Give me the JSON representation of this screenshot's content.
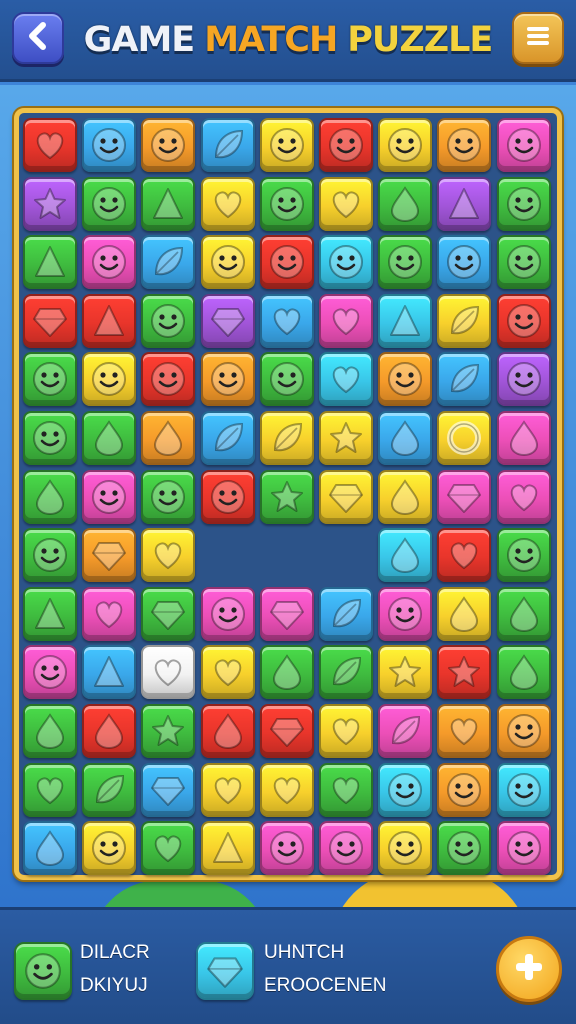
{
  "header": {
    "title_word1": "GAME",
    "title_word2": "MATCH",
    "title_word3": "PUZZLE",
    "back_icon": "chevron-left-icon",
    "menu_icon": "hamburger-menu-icon"
  },
  "colors": {
    "red": "#e8352b",
    "blue": "#3aa7ea",
    "orange": "#f59a2a",
    "cyan": "#39c6e8",
    "yellow": "#f7d02c",
    "pink": "#ec4fb7",
    "green": "#3fbb3f",
    "purple": "#a155d8",
    "white": "#f2f2f2",
    "board_frame": "#f0c24a"
  },
  "board": {
    "cols": 9,
    "rows": 13,
    "empty_cells": [
      [
        8,
        3
      ],
      [
        8,
        4
      ],
      [
        8,
        5
      ],
      [
        9,
        3
      ],
      [
        9,
        4
      ],
      [
        9,
        5
      ]
    ],
    "tiles": [
      [
        "red:heart",
        "blue:face",
        "orange:face",
        "blue:leaf",
        "yellow:face",
        "red:face",
        "yellow:face",
        "orange:face",
        "pink:face"
      ],
      [
        "purple:star",
        "green:face",
        "green:triangle",
        "yellow:heart",
        "green:face",
        "yellow:heart",
        "green:drop",
        "purple:triangle",
        "green:face"
      ],
      [
        "green:triangle",
        "pink:face",
        "blue:leaf",
        "yellow:face",
        "red:face",
        "cyan:face",
        "green:face",
        "blue:face",
        "green:face"
      ],
      [
        "red:gem",
        "red:triangle",
        "green:face",
        "purple:gem",
        "blue:heart",
        "pink:heart",
        "cyan:triangle",
        "yellow:leaf",
        "red:face"
      ],
      [
        "green:face",
        "yellow:face",
        "red:face",
        "orange:face",
        "green:face",
        "cyan:heart",
        "orange:face",
        "blue:leaf",
        "purple:face"
      ],
      [
        "green:face",
        "green:drop",
        "orange:drop",
        "blue:leaf",
        "yellow:leaf",
        "yellow:star",
        "blue:drop",
        "yellow:circle",
        "pink:drop"
      ],
      [
        "green:drop",
        "pink:face",
        "green:face",
        "red:face",
        "green:star",
        "yellow:gem",
        "yellow:drop",
        "pink:gem",
        "pink:heart"
      ],
      [
        "green:face",
        "orange:gem",
        "yellow:heart",
        "",
        "",
        "",
        "cyan:drop",
        "red:heart",
        "green:face"
      ],
      [
        "green:triangle",
        "pink:heart",
        "green:gem",
        "pink:face",
        "pink:gem",
        "blue:leaf",
        "pink:face",
        "yellow:drop",
        "green:drop"
      ],
      [
        "pink:face",
        "blue:triangle",
        "white:heart",
        "yellow:heart",
        "green:drop",
        "green:leaf",
        "yellow:star",
        "red:star",
        "green:drop"
      ],
      [
        "green:drop",
        "red:drop",
        "green:star",
        "red:drop",
        "red:gem",
        "yellow:heart",
        "pink:leaf",
        "orange:heart",
        "orange:face"
      ],
      [
        "green:heart",
        "green:leaf",
        "blue:gem",
        "yellow:heart",
        "yellow:heart",
        "green:heart",
        "cyan:face",
        "orange:face",
        "cyan:face"
      ],
      [
        "blue:drop",
        "yellow:face",
        "green:heart",
        "yellow:triangle",
        "pink:face",
        "pink:face",
        "yellow:face",
        "green:face",
        "pink:face"
      ]
    ]
  },
  "powerups": [
    {
      "label_line1": "DILACR",
      "label_line2": "DKIYUJ",
      "icon": "smiley-face-icon",
      "color": "#3fbb3f"
    },
    {
      "label_line1": "UHNTCH",
      "label_line2": "EROOCENEN",
      "icon": "gem-icon",
      "color": "#39c6e8"
    }
  ],
  "add_button": {
    "icon": "plus-icon"
  }
}
